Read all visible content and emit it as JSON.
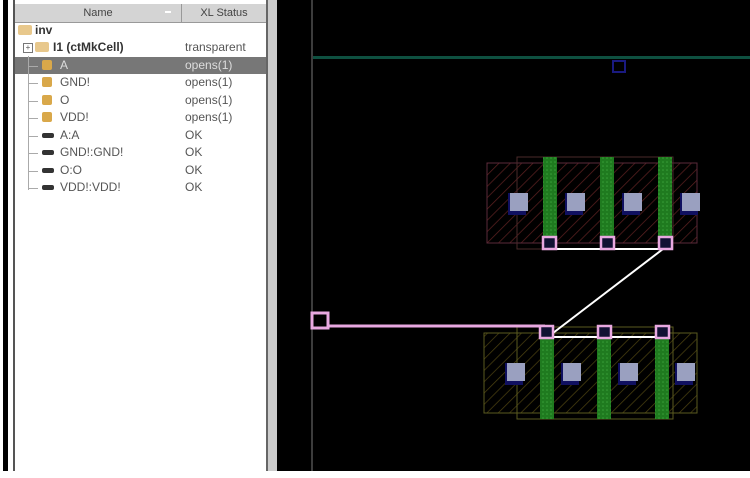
{
  "tree": {
    "columns": {
      "name": "Name",
      "status": "XL Status"
    },
    "root": {
      "label": "inv"
    },
    "rows": [
      {
        "name": "I1  (ctMkCell)",
        "status": "transparent",
        "type": "folder",
        "bold": true
      },
      {
        "name": "A",
        "status": "opens(1)",
        "type": "terminal",
        "selected": true
      },
      {
        "name": "GND!",
        "status": "opens(1)",
        "type": "terminal"
      },
      {
        "name": "O",
        "status": "opens(1)",
        "type": "terminal"
      },
      {
        "name": "VDD!",
        "status": "opens(1)",
        "type": "terminal"
      },
      {
        "name": "A:A",
        "status": "OK",
        "type": "connection"
      },
      {
        "name": "GND!:GND!",
        "status": "OK",
        "type": "connection"
      },
      {
        "name": "O:O",
        "status": "OK",
        "type": "connection"
      },
      {
        "name": "VDD!:VDD!",
        "status": "OK",
        "type": "connection"
      }
    ]
  },
  "colors": {
    "pin": "#e8a8e0",
    "poly": "#2a8a2a",
    "contact": "#9aa0c0",
    "rail": "#0e5040",
    "flightline": "#ffffff"
  }
}
